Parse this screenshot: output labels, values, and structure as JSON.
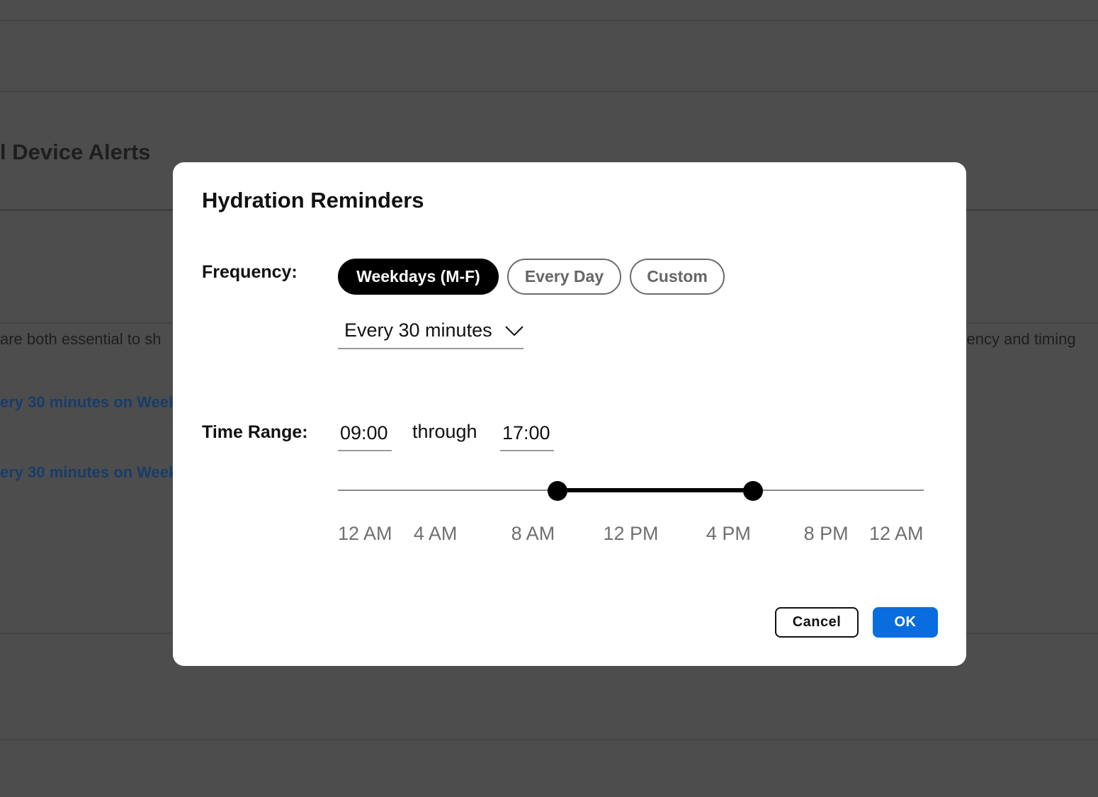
{
  "background": {
    "heading": "l Device Alerts",
    "body_text_left": "are both essential to sh",
    "body_text_right": "quency and timing",
    "links": [
      "ery 30 minutes on Week",
      "ery 30 minutes on Week"
    ]
  },
  "dialog": {
    "title": "Hydration Reminders",
    "frequency": {
      "label": "Frequency:",
      "options": [
        "Weekdays (M-F)",
        "Every Day",
        "Custom"
      ],
      "selected": "Weekdays (M-F)",
      "interval": {
        "value": "Every 30 minutes",
        "icon": "chevron-down-icon"
      }
    },
    "time_range": {
      "label": "Time Range:",
      "start": "09:00",
      "through_label": "through",
      "end": "17:00",
      "slider": {
        "range_start_hour": 9,
        "range_end_hour": 17,
        "min_hour": 0,
        "max_hour": 24,
        "tick_labels": [
          "12 AM",
          "4 AM",
          "8 AM",
          "12 PM",
          "4 PM",
          "8 PM",
          "12 AM"
        ]
      }
    },
    "buttons": {
      "cancel": "Cancel",
      "ok": "OK"
    },
    "colors": {
      "primary": "#0a6ddf",
      "selected_chip": "#000000",
      "overlay": "#4d4d4d"
    }
  }
}
